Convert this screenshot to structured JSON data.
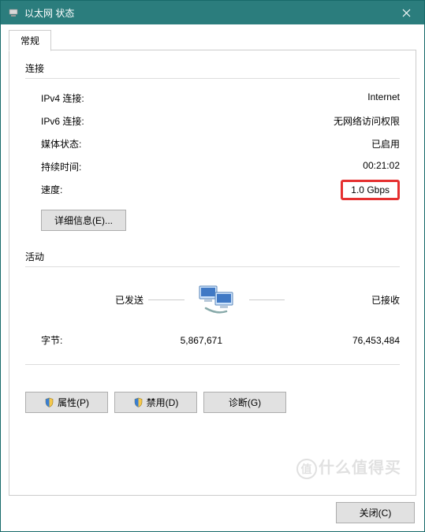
{
  "window": {
    "title": "以太网 状态"
  },
  "tabs": {
    "general": "常规"
  },
  "connection": {
    "section_title": "连接",
    "ipv4_label": "IPv4 连接:",
    "ipv4_value": "Internet",
    "ipv6_label": "IPv6 连接:",
    "ipv6_value": "无网络访问权限",
    "media_label": "媒体状态:",
    "media_value": "已启用",
    "duration_label": "持续时间:",
    "duration_value": "00:21:02",
    "speed_label": "速度:",
    "speed_value": "1.0 Gbps",
    "details_button": "详细信息(E)..."
  },
  "activity": {
    "section_title": "活动",
    "sent_label": "已发送",
    "received_label": "已接收",
    "bytes_label": "字节:",
    "bytes_sent": "5,867,671",
    "bytes_received": "76,453,484"
  },
  "buttons": {
    "properties": "属性(P)",
    "disable": "禁用(D)",
    "diagnose": "诊断(G)",
    "close": "关闭(C)"
  },
  "watermark": {
    "symbol": "值",
    "text": "什么值得买"
  }
}
